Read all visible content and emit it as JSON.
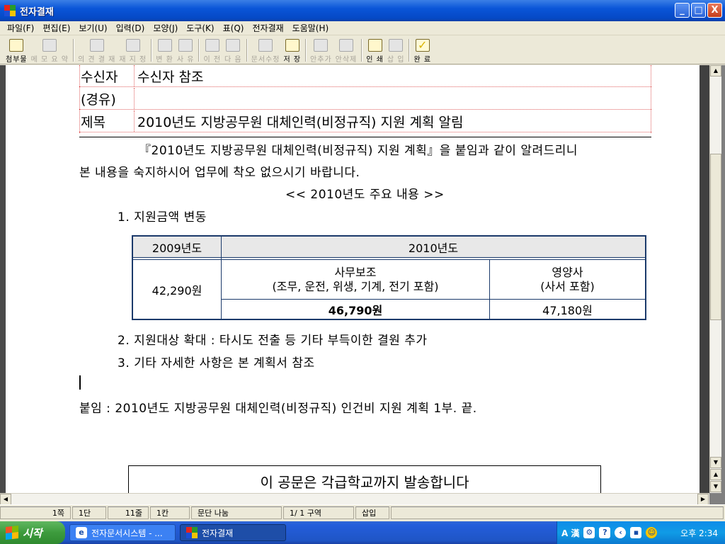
{
  "window": {
    "title": "전자결재",
    "min_label": "_",
    "max_label": "□",
    "close_label": "X"
  },
  "menu": [
    "파일(F)",
    "편집(E)",
    "보기(U)",
    "입력(D)",
    "모양(J)",
    "도구(K)",
    "표(Q)",
    "전자결재",
    "도움말(H)"
  ],
  "toolbar": [
    {
      "label": "첨부물",
      "enabled": true,
      "icon": "attach-icon"
    },
    {
      "label": "메 모 요 약",
      "enabled": false,
      "icon": "memo-icon"
    },
    {
      "label": "의 견 결 재",
      "enabled": false,
      "icon": "opinion-icon"
    },
    {
      "label": "재 지 정",
      "enabled": false,
      "icon": "reassign-icon"
    },
    {
      "label": "변 환",
      "enabled": false,
      "icon": "convert-icon"
    },
    {
      "label": "사 유",
      "enabled": false,
      "icon": "reason-icon"
    },
    {
      "label": "이 전",
      "enabled": false,
      "icon": "prev-icon"
    },
    {
      "label": "다 음",
      "enabled": false,
      "icon": "next-icon"
    },
    {
      "label": "문서수정",
      "enabled": false,
      "icon": "edit-doc-icon"
    },
    {
      "label": "저 장",
      "enabled": true,
      "icon": "save-icon"
    },
    {
      "label": "안추가",
      "enabled": false,
      "icon": "add-draft-icon"
    },
    {
      "label": "안삭제",
      "enabled": false,
      "icon": "delete-draft-icon"
    },
    {
      "label": "인 쇄",
      "enabled": true,
      "icon": "print-icon"
    },
    {
      "label": "삽 입",
      "enabled": false,
      "icon": "insert-icon"
    },
    {
      "label": "완 료",
      "enabled": true,
      "icon": "done-check-icon"
    }
  ],
  "header": {
    "recipient_key": "수신자",
    "recipient_val": "수신자 참조",
    "via_key": "(경유)",
    "via_val": "",
    "subject_key": "제목",
    "subject_val": "2010년도 지방공무원 대체인력(비정규직) 지원 계획 알림"
  },
  "body": {
    "para1_line1": "『2010년도 지방공무원 대체인력(비정규직) 지원 계획』을 붙임과 같이 알려드리니",
    "para1_line2": "본 내용을 숙지하시어 업무에 착오 없으시기 바랍니다.",
    "section_title": "<< 2010년도 주요 내용 >>",
    "item1": "1. 지원금액 변동",
    "item2": "2. 지원대상 확대 : 타시도 전출 등 기타 부득이한 결원 추가",
    "item3": "3. 기타 자세한 사항은 본 계획서 참조",
    "attachment": "붙임 : 2010년도 지방공무원 대체인력(비정규직) 인건비 지원 계획 1부.   끝.",
    "send_note": "이 공문은 각급학교까지 발송합니다"
  },
  "amount_table": {
    "col_2009": "2009년도",
    "col_2010": "2010년도",
    "val_2009": "42,290원",
    "office_title": "사무보조",
    "office_sub": "(조무, 운전, 위생, 기계, 전기 포함)",
    "office_val": "46,790원",
    "nutri_title": "영양사",
    "nutri_sub": "(사서 포함)",
    "nutri_val": "47,180원"
  },
  "status": [
    "1쪽",
    "1단",
    "11줄",
    "1칸",
    "문단 나눔",
    "1/ 1 구역",
    "삽입"
  ],
  "taskbar": {
    "start": "시작",
    "tasks": [
      {
        "label": "전자문서시스템 - ...",
        "active": false
      },
      {
        "label": "전자결재",
        "active": true
      }
    ],
    "tray_ime": "A 漢",
    "clock": "오후 2:34"
  }
}
